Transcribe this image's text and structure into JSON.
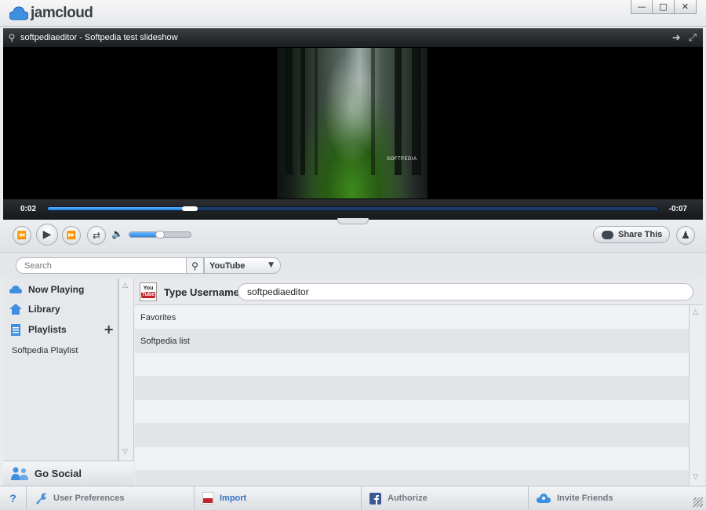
{
  "app": {
    "name": "jamcloud"
  },
  "window_controls": {
    "minimize": "—",
    "maximize": "□",
    "close": "✕"
  },
  "player": {
    "title": "softpediaeditor - Softpedia test slideshow",
    "elapsed": "0:02",
    "remaining": "-0:07",
    "progress": 0.23,
    "volume": 0.5,
    "artwork_caption": "SOFTPEDIA"
  },
  "controls": {
    "share_label": "Share This"
  },
  "search": {
    "placeholder": "Search",
    "source": "YouTube"
  },
  "sidebar": {
    "items": [
      {
        "label": "Now Playing",
        "icon": "cloud-icon"
      },
      {
        "label": "Library",
        "icon": "home-icon"
      },
      {
        "label": "Playlists",
        "icon": "document-icon"
      }
    ],
    "playlists": [
      "Softpedia Playlist"
    ],
    "go_social": "Go Social"
  },
  "main": {
    "username_label": "Type Username",
    "username_value": "softpediaeditor",
    "rows": [
      "Favorites",
      "Softpedia list",
      "",
      "",
      "",
      "",
      "",
      ""
    ]
  },
  "bottom": {
    "help": "?",
    "items": [
      {
        "label": "User Preferences",
        "icon": "wrench-icon"
      },
      {
        "label": "Import",
        "icon": "youtube-icon"
      },
      {
        "label": "Authorize",
        "icon": "facebook-icon"
      },
      {
        "label": "Invite Friends",
        "icon": "people-icon"
      }
    ]
  },
  "colors": {
    "accent": "#3574c4",
    "progress": "#1d7ad8",
    "youtube_red": "#c4232a",
    "facebook_blue": "#3b5998"
  }
}
